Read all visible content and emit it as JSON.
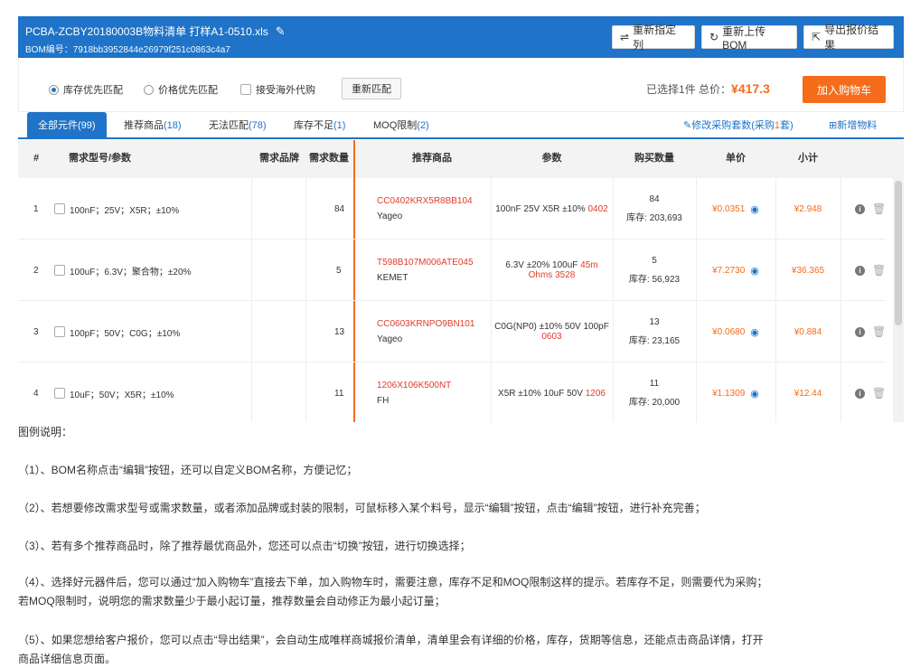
{
  "header": {
    "title": "PCBA-ZCBY20180003B物料清单 打样A1-0510.xls",
    "bom_id": "BOM编号：7918bb3952844e26979f251c0863c4a7",
    "buttons": [
      {
        "label": "重新指定列",
        "icon": "⇌"
      },
      {
        "label": "重新上传BOM",
        "icon": "↻"
      },
      {
        "label": "导出报价结果",
        "icon": "⇱"
      }
    ]
  },
  "options": {
    "radio1": "库存优先匹配",
    "radio2": "价格优先匹配",
    "checkbox": "接受海外代购",
    "rematch": "重新匹配",
    "selected_prefix": "已选择",
    "selected_count": "1",
    "selected_suffix": "件  总价：",
    "total": "¥417.3",
    "cart": "加入购物车"
  },
  "tabs": [
    {
      "label": "全部元件",
      "count": "(99)"
    },
    {
      "label": "推荐商品",
      "count": "(18)"
    },
    {
      "label": "无法匹配",
      "count": "(78)"
    },
    {
      "label": "库存不足",
      "count": "(1)"
    },
    {
      "label": "MOQ限制",
      "count": "(2)"
    }
  ],
  "tab_right": {
    "modify_prefix": "修改采购套数(采购",
    "modify_count": "1",
    "modify_suffix": "套)",
    "add": "新增物料"
  },
  "columns": [
    "#",
    "需求型号/参数",
    "需求品牌",
    "需求数量",
    "推荐商品",
    "参数",
    "购买数量",
    "单价",
    "小计"
  ],
  "rows": [
    {
      "num": "1",
      "spec": "100nF；25V；X5R；±10%",
      "qty": "84",
      "part": "CC0402KRX5R8BB104",
      "mfr": "Yageo",
      "param": "100nF 25V X5R ±10%",
      "param_red": "0402",
      "buy": "84",
      "stock": "库存: 203,693",
      "unit": "¥0.0351",
      "subtotal": "¥2.948"
    },
    {
      "num": "2",
      "spec": "100uF；6.3V；聚合物；±20%",
      "qty": "5",
      "part": "T598B107M006ATE045",
      "mfr": "KEMET",
      "param": "6.3V ±20% 100uF",
      "param_red": "45m Ohms 3528",
      "buy": "5",
      "stock": "库存: 56,923",
      "unit": "¥7.2730",
      "subtotal": "¥36.365"
    },
    {
      "num": "3",
      "spec": "100pF；50V；C0G；±10%",
      "qty": "13",
      "part": "CC0603KRNPO9BN101",
      "mfr": "Yageo",
      "param": "C0G(NP0) ±10% 50V 100pF",
      "param_red": "0603",
      "buy": "13",
      "stock": "库存: 23,165",
      "unit": "¥0.0680",
      "subtotal": "¥0.884"
    },
    {
      "num": "4",
      "spec": "10uF；50V；X5R；±10%",
      "qty": "11",
      "part": "1206X106K500NT",
      "mfr": "FH",
      "param": "X5R ±10% 10uF 50V",
      "param_red": "1206",
      "buy": "11",
      "stock": "库存: 20,000",
      "unit": "¥1.1309",
      "subtotal": "¥12.44"
    }
  ],
  "doc": {
    "heading": "图例说明：",
    "p1": "（1）、BOM名称点击“编辑”按钮，还可以自定义BOM名称，方便记忆；",
    "p2": "（2）、若想要修改需求型号或需求数量，或者添加品牌或封装的限制，可鼠标移入某个料号，显示“编辑”按钮，点击“编辑”按钮，进行补充完善；",
    "p3": "（3）、若有多个推荐商品时，除了推荐最优商品外，您还可以点击“切换”按钮，进行切换选择；",
    "p4a": "（4）、选择好元器件后，您可以通过“加入购物车”直接去下单，加入购物车时，需要注意，库存不足和MOQ限制这样的提示。若库存不足，则需要代为采购；",
    "p4b": "若MOQ限制时，说明您的需求数量少于最小起订量，推荐数量会自动修正为最小起订量；",
    "p5a": "（5）、如果您想给客户报价，您可以点击“导出结果”，会自动生成唯样商城报价清单，清单里会有详细的价格，库存，货期等信息，还能点击商品详情，打开",
    "p5b": "商品详细信息页面。"
  }
}
